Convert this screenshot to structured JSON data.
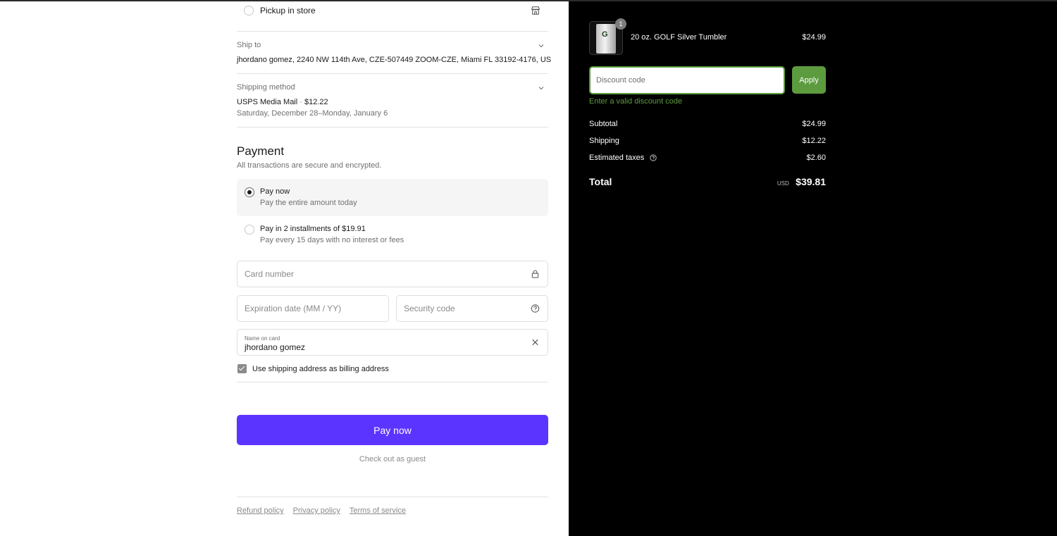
{
  "delivery": {
    "pickup_label": "Pickup in store"
  },
  "ship_to": {
    "label": "Ship to",
    "address": "jhordano gomez, 2240 NW 114th Ave, CZE-507449 ZOOM-CZE, Miami FL 33192-4176, US"
  },
  "shipping_method": {
    "label": "Shipping method",
    "name": "USPS Media Mail",
    "separator": "·",
    "price": "$12.22",
    "dates": "Saturday, December 28–Monday, January 6"
  },
  "payment": {
    "title": "Payment",
    "subtitle": "All transactions are secure and encrypted.",
    "options": [
      {
        "title": "Pay now",
        "subtitle": "Pay the entire amount today",
        "selected": true
      },
      {
        "title": "Pay in 2 installments of $19.91",
        "subtitle": "Pay every 15 days with no interest or fees",
        "selected": false
      }
    ],
    "card_number_placeholder": "Card number",
    "expiration_placeholder": "Expiration date (MM / YY)",
    "security_placeholder": "Security code",
    "name_label": "Name on card",
    "name_value": "jhordano gomez",
    "billing_checkbox_label": "Use shipping address as billing address",
    "pay_button": "Pay now",
    "guest_link": "Check out as guest"
  },
  "footer": {
    "links": [
      "Refund policy",
      "Privacy policy",
      "Terms of service"
    ]
  },
  "summary": {
    "product": {
      "name": "20 oz. GOLF Silver Tumbler",
      "price": "$24.99",
      "quantity": "1"
    },
    "discount_placeholder": "Discount code",
    "apply_button": "Apply",
    "discount_error": "Enter a valid discount code",
    "subtotal_label": "Subtotal",
    "subtotal": "$24.99",
    "shipping_label": "Shipping",
    "shipping": "$12.22",
    "taxes_label": "Estimated taxes",
    "taxes": "$2.60",
    "total_label": "Total",
    "currency": "USD",
    "total": "$39.81"
  },
  "colors": {
    "pay_button": "#5c34ff",
    "accent_green": "#5d9b3f",
    "summary_background": "#000000"
  },
  "icons": [
    "store-icon",
    "chevron-down-icon",
    "lock-icon",
    "help-circle-icon",
    "clear-icon",
    "check-icon",
    "info-icon"
  ]
}
